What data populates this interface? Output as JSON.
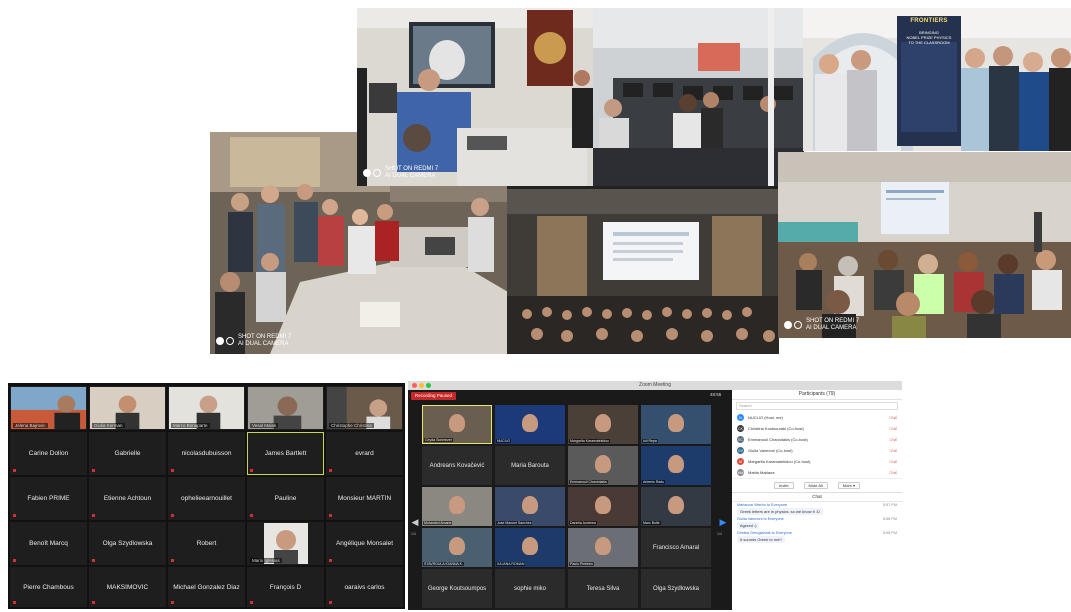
{
  "watermark": {
    "line1": "SHOT ON REDMI 7",
    "line2": "AI DUAL CAMERA"
  },
  "banner": {
    "brand": "FRONTIERS",
    "line1": "BRINGING",
    "line2": "NOBEL PRIZE PHYSICS",
    "line3": "TO THE CLASSROOM"
  },
  "zoom_grid_1": {
    "video_row": [
      {
        "caption": "Jelena Bajrovic"
      },
      {
        "caption": "Giulia Korman"
      },
      {
        "caption": "Marco Bonaparte"
      },
      {
        "caption": "Vesal Malak"
      },
      {
        "caption": "Christophe Christina"
      }
    ],
    "rows": [
      [
        "Carine Dollon",
        "Gabrielle",
        "nicolasdubuisson",
        "James Bartlett",
        "evrard"
      ],
      [
        "Fabien PRIME",
        "Etienne Achtoun",
        "ophelieearnouillet",
        "Pauline",
        "Monsieur MARTIN"
      ],
      [
        "Benoît Marcq",
        "Olga Szydlowska",
        "Robert",
        "",
        "Angélique Monsalet"
      ],
      [
        "Pierre Chambous",
        "MAKSIMOVIC",
        "Michael Gonzalez Diaz",
        "François D",
        "oaraivs carlos"
      ]
    ],
    "robert_video_caption": "Mario Iglesias"
  },
  "zoom_window_2": {
    "title": "Zoom Meeting",
    "recording": "Recording Paused",
    "timer": "48:55",
    "tiles": [
      {
        "name": "",
        "caption": "Ceyda Sonmezer"
      },
      {
        "name": "",
        "caption": "NUCLIO"
      },
      {
        "name": "",
        "caption": "Margarita Karamalekidou"
      },
      {
        "name": "",
        "caption": "Ioli Repa"
      },
      {
        "name": "Andreans Kovačević",
        "caption": ""
      },
      {
        "name": "Maria Barouta",
        "caption": ""
      },
      {
        "name": "",
        "caption": "Emmanouil Chaniotakis"
      },
      {
        "name": "",
        "caption": "Artemis Radu"
      },
      {
        "name": "",
        "caption": "Mohamed Amane"
      },
      {
        "name": "",
        "caption": "Jose Manuel Sanchez"
      },
      {
        "name": "",
        "caption": "Daniela Andreea"
      },
      {
        "name": "",
        "caption": "Marc Bollé"
      },
      {
        "name": "",
        "caption": "STAVROULA IOANNA K."
      },
      {
        "name": "",
        "caption": "IULIANA ROMAN"
      },
      {
        "name": "",
        "caption": "Paulo Pinheiro"
      },
      {
        "name": "Francisco Amaral",
        "caption": ""
      },
      {
        "name": "George Koutsoumpos",
        "caption": ""
      },
      {
        "name": "sophie miko",
        "caption": ""
      },
      {
        "name": "Teresa Silva",
        "caption": ""
      },
      {
        "name": "Olga Szydlowska",
        "caption": ""
      }
    ],
    "page_left": "1/4",
    "page_right": "1/4",
    "participants": {
      "title": "Participants (79)",
      "search_placeholder": "Search",
      "list": [
        {
          "initials": "N",
          "name": "NUCLIO (Host, me)",
          "color": "#2d8cff"
        },
        {
          "initials": "CK",
          "name": "Christina Koutsouraki (Co-host)",
          "color": "#3a3a3a"
        },
        {
          "initials": "EC",
          "name": "Emmanouil Chaniotakis (Co-host)",
          "color": "#5a6a7a"
        },
        {
          "initials": "GV",
          "name": "Giulia Vanmoni (Co-host)",
          "color": "#2f6e8e"
        },
        {
          "initials": "M",
          "name": "Margarita Karamalekidou (Co-host)",
          "color": "#e04a3a"
        },
        {
          "initials": "MM",
          "name": "Mattia Mattana",
          "color": "#888888"
        }
      ],
      "buttons": [
        "Invite",
        "Mute All",
        "More ▾"
      ]
    },
    "chat": {
      "title": "Chat",
      "messages": [
        {
          "from": "Marianna Viterbo to Everyone",
          "time": "5:57 PM",
          "text": "Greek letters are in physics, so we know it :D"
        },
        {
          "from": "Giulia Vanmoni to Everyone",
          "time": "5:58 PM",
          "text": "Agreed :)"
        },
        {
          "from": "Dimitra Gerogiannis to Everyone",
          "time": "5:58 PM",
          "text": "It sounds Greek to me!!"
        }
      ]
    }
  }
}
